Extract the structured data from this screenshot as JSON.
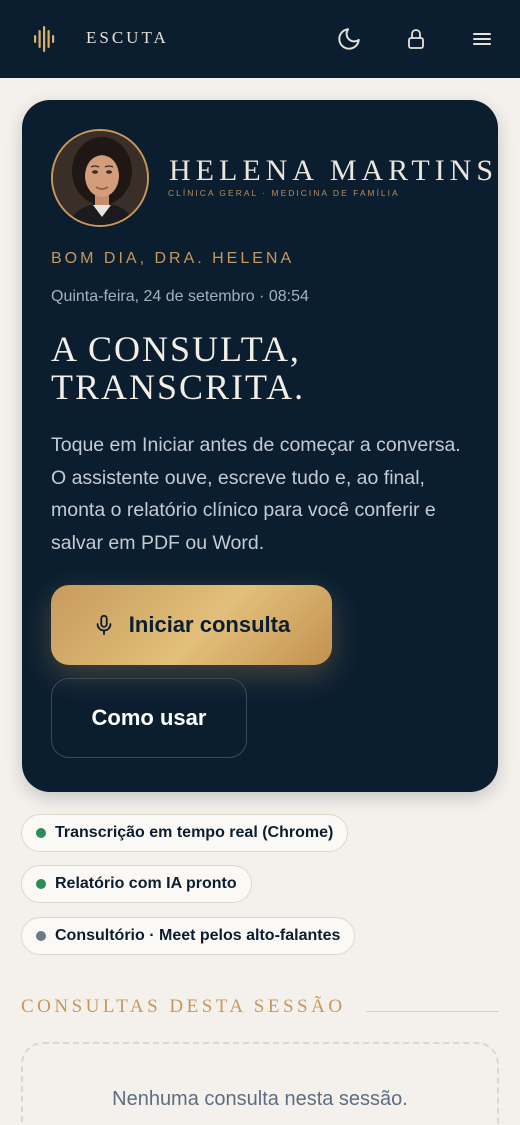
{
  "header": {
    "brand": "ESCUTA",
    "icons": [
      "sound-wave-logo-icon",
      "moon-icon",
      "lock-icon",
      "menu-icon"
    ]
  },
  "hero": {
    "doctor_name": "HELENA MARTINS",
    "specialty": "CLÍNICA GERAL · MEDICINA DE FAMÍLIA",
    "greeting": "BOM DIA, DRA. HELENA",
    "datetime": "Quinta-feira, 24 de setembro · 08:54",
    "headline_line1": "A CONSULTA,",
    "headline_line2": "TRANSCRITA.",
    "intro": "Toque em Iniciar antes de começar a conversa. O assistente ouve, escreve tudo e, ao final, monta o relatório clínico para você conferir e salvar em PDF ou Word.",
    "start_button": "Iniciar consulta",
    "how_button": "Como usar"
  },
  "status_chips": [
    {
      "label": "Transcrição em tempo real (Chrome)",
      "color": "#2e8b57"
    },
    {
      "label": "Relatório com IA pronto",
      "color": "#2e8b57"
    },
    {
      "label": "Consultório · Meet pelos alto-falantes",
      "color": "#6b7889"
    }
  ],
  "sessions": {
    "title": "CONSULTAS DESTA SESSÃO",
    "empty_line1": "Nenhuma consulta nesta sessão.",
    "empty_line2": ""
  },
  "colors": {
    "navy": "#0b1e30",
    "gold": "#c9975d",
    "background": "#f4f1ec"
  }
}
